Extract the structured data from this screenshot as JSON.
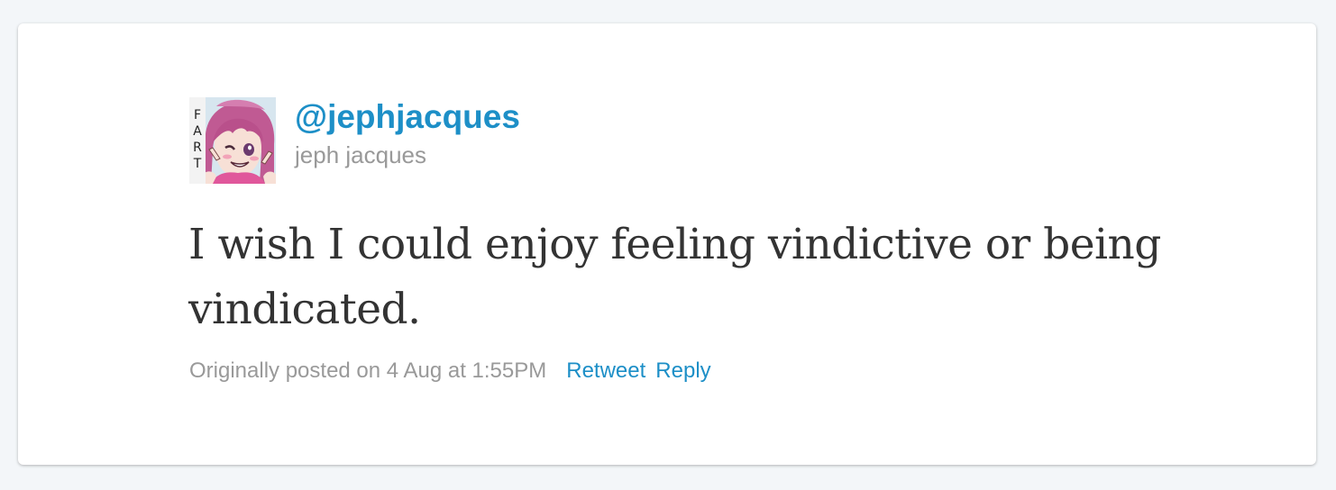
{
  "tweet": {
    "handle": "@jephjacques",
    "name": "jeph jacques",
    "text": "I wish I could enjoy feeling vindictive or being vindicated.",
    "posted": "Originally posted on 4 Aug at 1:55PM",
    "actions": {
      "retweet": "Retweet",
      "reply": "Reply"
    }
  },
  "colors": {
    "background": "#f3f6f9",
    "card": "#ffffff",
    "link": "#1d8fc7",
    "muted": "#999999",
    "text": "#333333"
  },
  "icons": {
    "avatar": "anime-character-avatar"
  }
}
